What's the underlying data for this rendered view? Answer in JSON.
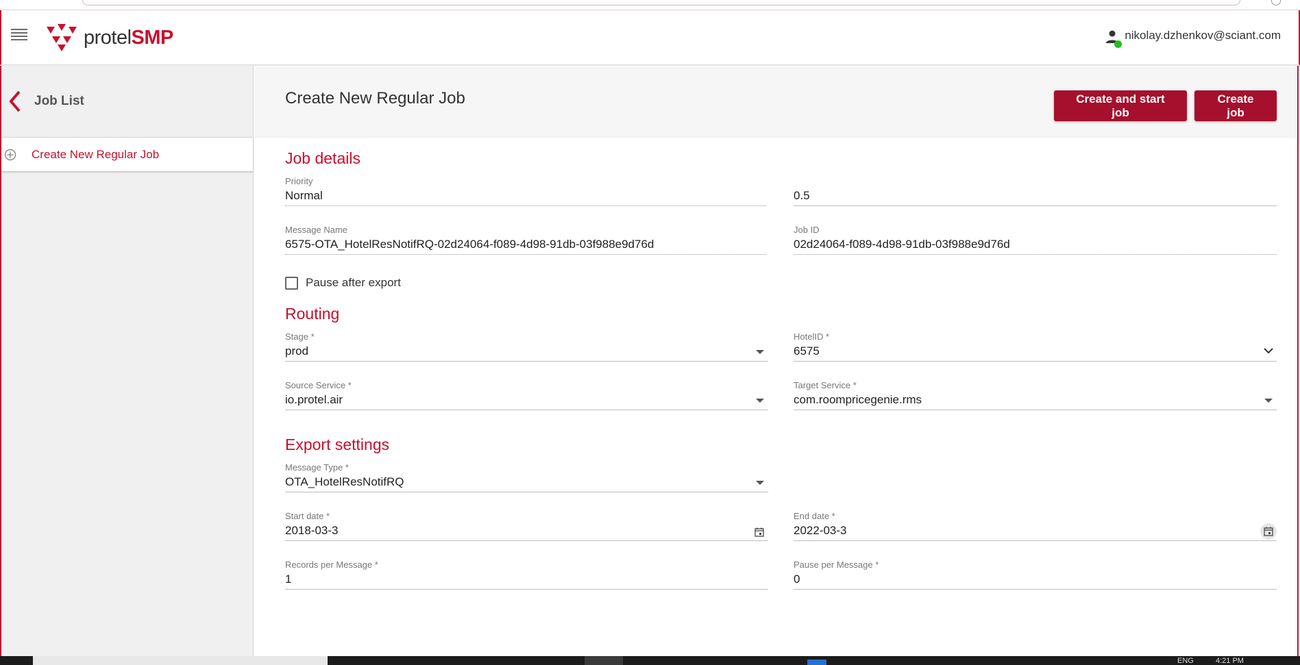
{
  "app": {
    "logo_text_regular": "protel",
    "logo_text_bold": "SMP",
    "brand_color": "#c8102e",
    "button_color": "#a6102d"
  },
  "header": {
    "user_email": "nikolay.dzhenkov@sciant.com"
  },
  "sidebar": {
    "back_label": "Job List",
    "items": [
      {
        "label": "Create New Regular Job",
        "icon": "add-circle-icon"
      }
    ]
  },
  "page": {
    "title": "Create New Regular Job",
    "buttons": {
      "create_and_start": "Create and start job",
      "create": "Create job"
    }
  },
  "job_details": {
    "title": "Job details",
    "priority": {
      "label": "Priority",
      "value": "Normal"
    },
    "priority_value": {
      "value": "0.5"
    },
    "message_name": {
      "label": "Message Name",
      "value": "6575-OTA_HotelResNotifRQ-02d24064-f089-4d98-91db-03f988e9d76d"
    },
    "job_id": {
      "label": "Job ID",
      "value": "02d24064-f089-4d98-91db-03f988e9d76d"
    },
    "pause_after_export": {
      "label": "Pause after export",
      "checked": false
    }
  },
  "routing": {
    "title": "Routing",
    "stage": {
      "label": "Stage *",
      "value": "prod"
    },
    "hotel_id": {
      "label": "HotelID *",
      "value": "6575"
    },
    "source_service": {
      "label": "Source Service *",
      "value": "io.protel.air"
    },
    "target_service": {
      "label": "Target Service *",
      "value": "com.roompricegenie.rms"
    }
  },
  "export_settings": {
    "title": "Export settings",
    "message_type": {
      "label": "Message Type *",
      "value": "OTA_HotelResNotifRQ"
    },
    "start_date": {
      "label": "Start date *",
      "value": "2018-03-3"
    },
    "end_date": {
      "label": "End date *",
      "value": "2022-03-3"
    },
    "records_per_message": {
      "label": "Records per Message *",
      "value": "1"
    },
    "pause_per_message": {
      "label": "Pause per Message *",
      "value": "0"
    }
  },
  "taskbar": {
    "language": "ENG",
    "time": "4:21 PM"
  }
}
